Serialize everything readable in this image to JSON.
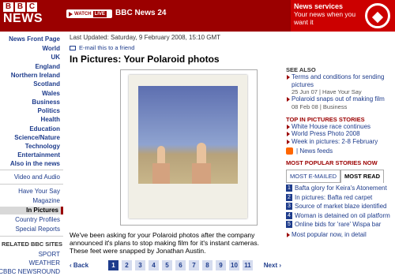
{
  "header": {
    "logo_letters": [
      "B",
      "B",
      "C"
    ],
    "logo_word": "NEWS",
    "watch_label": "WATCH",
    "live_label": "LIVE",
    "channel": "BBC News 24",
    "services_title": "News services",
    "services_text": "Your news when you want it",
    "colors": {
      "header_bg": "#9b0000",
      "services_bg": "#cc0000",
      "link": "#1e3c8c"
    }
  },
  "leftnav": {
    "items": [
      "News Front Page",
      "World",
      "UK",
      "England",
      "Northern Ireland",
      "Scotland",
      "Wales",
      "Business",
      "Politics",
      "Health",
      "Education",
      "Science/Nature",
      "Technology",
      "Entertainment",
      "Also in the news"
    ],
    "extra": [
      "Video and Audio"
    ],
    "secondary": [
      "Have Your Say",
      "Magazine",
      "In Pictures",
      "Country Profiles",
      "Special Reports"
    ],
    "selected": "In Pictures",
    "related_heading": "RELATED BBC SITES",
    "related": [
      "SPORT",
      "WEATHER",
      "CBBC NEWSROUND"
    ]
  },
  "main": {
    "last_updated": "Last Updated: Saturday, 9 February 2008, 15:10 GMT",
    "email_link": "E-mail this to a friend",
    "title": "In Pictures: Your Polaroid photos",
    "caption": "We've been asking for your Polaroid photos after the company announced it's plans to stop making film for it's instant cameras. These feet were snapped by Jonathan Austin.",
    "photo_icon": "polaroid-photo"
  },
  "pager": {
    "back": "Back",
    "next": "Next",
    "pages": [
      "1",
      "2",
      "3",
      "4",
      "5",
      "6",
      "7",
      "8",
      "9",
      "10",
      "11"
    ],
    "current": "1"
  },
  "right": {
    "see_also_heading": "SEE ALSO",
    "see_also": [
      {
        "title": "Terms and conditions for sending pictures",
        "date": "25 Jun 07 | Have Your Say"
      },
      {
        "title": "Polaroid snaps out of making film",
        "date": "08 Feb 08 | Business"
      }
    ],
    "top_heading": "TOP IN PICTURES STORIES",
    "top": [
      "White House race continues",
      "World Press Photo 2008",
      "Week in pictures: 2-8 February"
    ],
    "feeds": "News feeds",
    "popular_heading": "MOST POPULAR STORIES NOW",
    "tab_emailed": "MOST E-MAILED",
    "tab_read": "MOST READ",
    "popular": [
      "Bafta glory for Keira's Atonement",
      "In pictures: Bafta red carpet",
      "Source of market blaze identified",
      "Woman is detained on oil platform",
      "Online bids for 'rare' Wispa bar"
    ],
    "more_link": "Most popular now, in detail"
  }
}
